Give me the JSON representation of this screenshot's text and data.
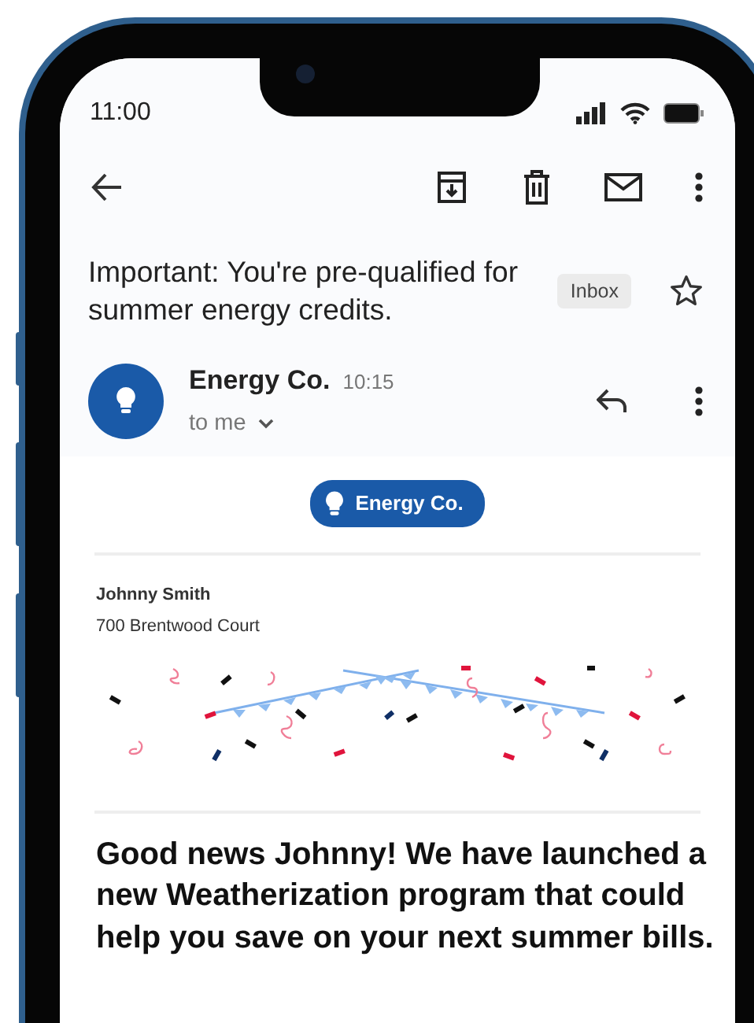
{
  "status_bar": {
    "time": "11:00"
  },
  "email": {
    "subject": "Important: You're pre-qualified for summer energy credits.",
    "label": "Inbox",
    "starred": false,
    "sender": "Energy Co.",
    "time": "10:15",
    "recipient": "to me"
  },
  "body": {
    "logo_text": "Energy Co.",
    "addressee_name": "Johnny Smith",
    "addressee_address": "700 Brentwood Court",
    "headline": "Good news Johnny! We have launched a new Weatherization program that could help you save on your next summer bills."
  }
}
